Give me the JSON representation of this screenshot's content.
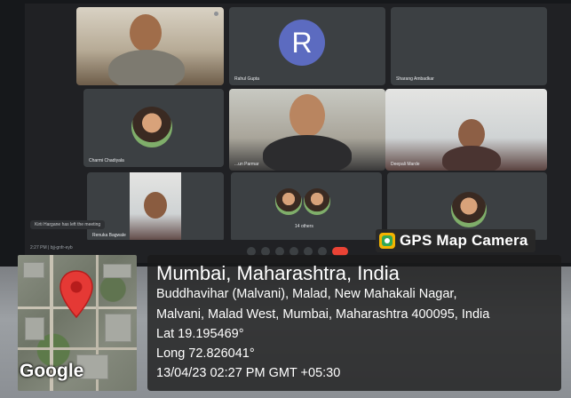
{
  "meeting": {
    "participants": [
      {
        "name": ""
      },
      {
        "name": "Rahul Gupta"
      },
      {
        "name": "Sharang Ambadkar"
      },
      {
        "name": "Charmi Chadiyala"
      },
      {
        "name": "...un Parmar"
      },
      {
        "name": "Deepali Marde"
      },
      {
        "name": ""
      },
      {
        "name": "Renuka Bagwale"
      },
      {
        "name": "14 others"
      }
    ],
    "avatar_letter": "R",
    "avatar_color": "#5c6bc0",
    "toast": "Kirti Hargane has left the meeting",
    "time_label": "2:27 PM | bjj-gnfr-eyb"
  },
  "badge": {
    "label": "GPS Map Camera",
    "icon": "gps-map-camera-icon"
  },
  "location": {
    "title": "Mumbai, Maharashtra, India",
    "address_line1": "Buddhavihar (Malvani), Malad, New Mahakali Nagar,",
    "address_line2": "Malvani, Malad West, Mumbai, Maharashtra 400095, India",
    "lat": "Lat 19.195469°",
    "long": "Long 72.826041°",
    "datetime": "13/04/23 02:27 PM GMT +05:30"
  },
  "map": {
    "logo": "Google",
    "pin_color": "#e53935",
    "icon": "map-pin-icon"
  }
}
